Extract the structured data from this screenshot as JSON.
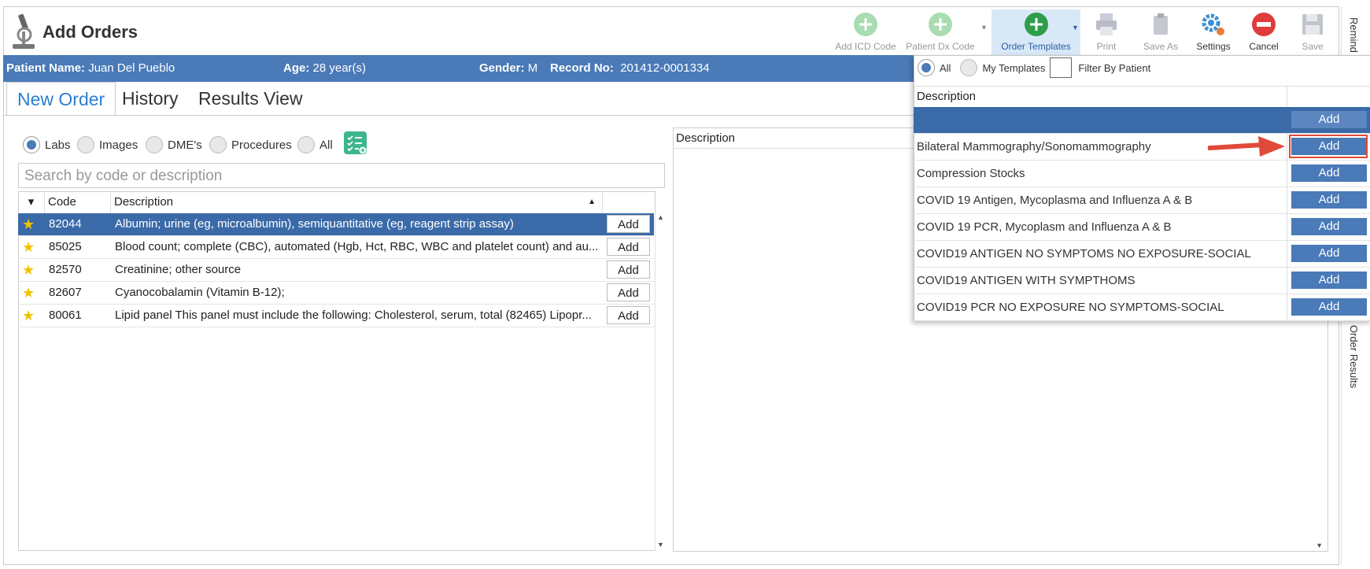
{
  "app": {
    "title": "Add Orders"
  },
  "toolbar": {
    "add_icd_code": "Add ICD Code",
    "patient_dx_code": "Patient Dx Code",
    "order_templates": "Order Templates",
    "print": "Print",
    "save_as": "Save As",
    "settings": "Settings",
    "cancel": "Cancel",
    "save": "Save"
  },
  "patient": {
    "name_label": "Patient Name:",
    "name": "Juan Del Pueblo",
    "age_label": "Age:",
    "age": "28 year(s)",
    "gender_label": "Gender:",
    "gender": "M",
    "record_label": "Record No:",
    "record": "201412-0001334"
  },
  "tabs": [
    "New Order",
    "History",
    "Results View"
  ],
  "filters": {
    "labs": "Labs",
    "images": "Images",
    "dmes": "DME's",
    "procedures": "Procedures",
    "all": "All"
  },
  "search": {
    "placeholder": "Search by code or description"
  },
  "grid": {
    "headers": {
      "code": "Code",
      "description": "Description"
    },
    "add_label": "Add",
    "rows": [
      {
        "code": "82044",
        "description": "Albumin; urine (eg, microalbumin), semiquantitative (eg, reagent strip assay)"
      },
      {
        "code": "85025",
        "description": "Blood count; complete (CBC), automated (Hgb, Hct, RBC, WBC and platelet count) and au..."
      },
      {
        "code": "82570",
        "description": "Creatinine; other source"
      },
      {
        "code": "82607",
        "description": "Cyanocobalamin (Vitamin B-12);"
      },
      {
        "code": "80061",
        "description": "Lipid panel This panel must include the following: Cholesterol, serum, total (82465) Lipopr..."
      }
    ]
  },
  "mid_panel": {
    "header": "Description"
  },
  "side": {
    "reminders": "Remind",
    "order_results": "Order Results"
  },
  "popup": {
    "all": "All",
    "my_templates": "My Templates",
    "filter_by_patient": "Filter By Patient",
    "header": "Description",
    "add_label": "Add",
    "rows": [
      "",
      "Bilateral Mammography/Sonomammography",
      "Compression Stocks",
      "COVID 19 Antigen, Mycoplasma and Influenza A & B",
      "COVID 19 PCR, Mycoplasm and Influenza A & B",
      "COVID19 ANTIGEN NO SYMPTOMS NO EXPOSURE-SOCIAL",
      "COVID19 ANTIGEN WITH SYMPTHOMS",
      "COVID19 PCR NO EXPOSURE NO SYMPTOMS-SOCIAL"
    ]
  },
  "colors": {
    "accent": "#4a7ab7",
    "selected_row": "#3a6aa8",
    "highlight": "#e04a3a",
    "tab_active": "#2a7fd3"
  }
}
